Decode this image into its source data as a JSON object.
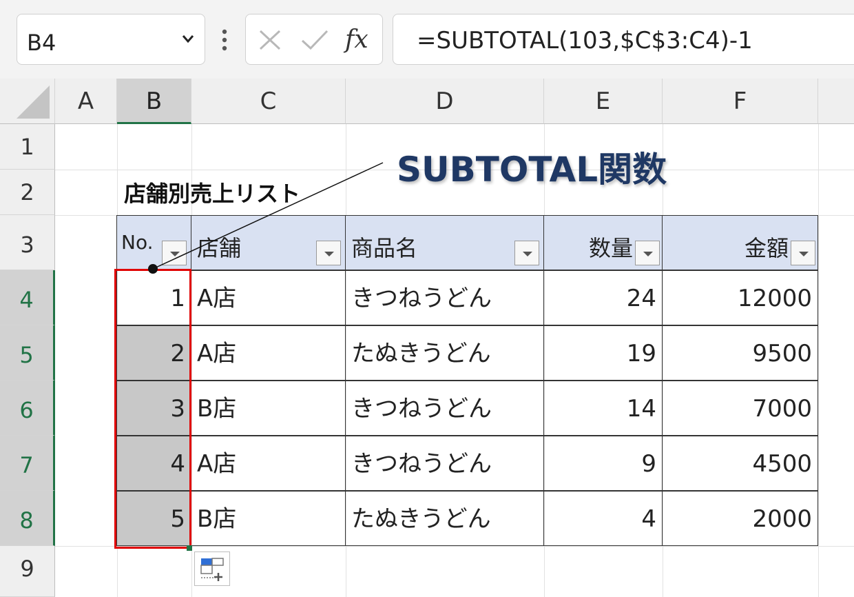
{
  "formula_bar": {
    "name_box": "B4",
    "fx_label": "fx",
    "formula": "=SUBTOTAL(103,$C$3:C4)-1"
  },
  "grid": {
    "columns": [
      "A",
      "B",
      "C",
      "D",
      "E",
      "F"
    ],
    "rows": [
      "1",
      "2",
      "3",
      "4",
      "5",
      "6",
      "7",
      "8",
      "9"
    ],
    "selected_column": "B",
    "selected_rows": [
      "4",
      "5",
      "6",
      "7",
      "8"
    ]
  },
  "sheet": {
    "title": "店舗別売上リスト",
    "headers": [
      "No.",
      "店舗",
      "商品名",
      "数量",
      "金額"
    ],
    "rows": [
      {
        "no": "1",
        "store": "A店",
        "product": "きつねうどん",
        "qty": "24",
        "amount": "12000"
      },
      {
        "no": "2",
        "store": "A店",
        "product": "たぬきうどん",
        "qty": "19",
        "amount": "9500"
      },
      {
        "no": "3",
        "store": "B店",
        "product": "きつねうどん",
        "qty": "14",
        "amount": "7000"
      },
      {
        "no": "4",
        "store": "A店",
        "product": "きつねうどん",
        "qty": "9",
        "amount": "4500"
      },
      {
        "no": "5",
        "store": "B店",
        "product": "たぬきうどん",
        "qty": "4",
        "amount": "2000"
      }
    ]
  },
  "annotation": {
    "callout": "SUBTOTAL関数",
    "color": "#1f3864"
  },
  "colors": {
    "header_fill": "#d9e1f2",
    "selection_border": "#e00000",
    "excel_green": "#217346"
  }
}
